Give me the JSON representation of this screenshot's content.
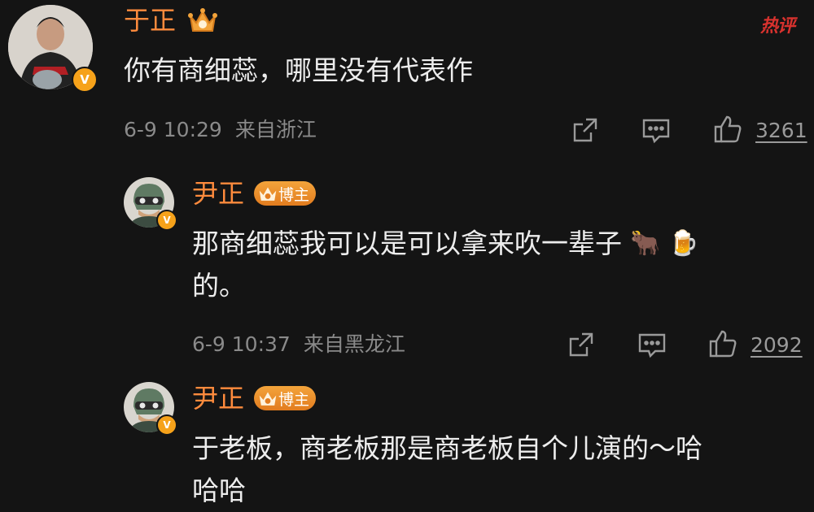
{
  "hot_label": "热评",
  "comments": [
    {
      "username": "于正",
      "text_lines": [
        "你有商细蕊，哪里没有代表作"
      ],
      "date": "6-9 10:29",
      "location": "来自浙江",
      "likes": "3261"
    },
    {
      "username": "尹正",
      "badge": "博主",
      "text_lines": [
        "那商细蕊我可以是可以拿来吹一辈子",
        "的。"
      ],
      "emoji": [
        "🐂",
        "🍺"
      ],
      "date": "6-9 10:37",
      "location": "来自黑龙江",
      "likes": "2092"
    },
    {
      "username": "尹正",
      "badge": "博主",
      "text_lines": [
        "于老板，商老板那是商老板自个儿演的～哈",
        "哈哈"
      ]
    }
  ]
}
